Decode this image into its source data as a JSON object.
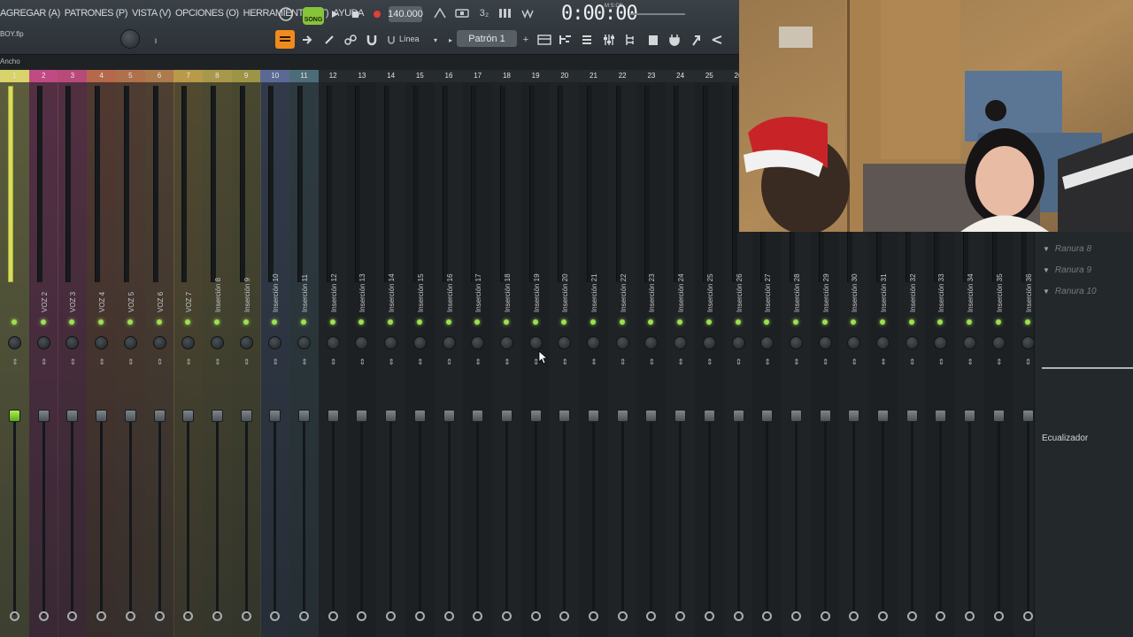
{
  "menu": [
    "AGREGAR (A)",
    "PATRONES (P)",
    "VISTA (V)",
    "OPCIONES (O)",
    "HERRAMIENTAS (T)",
    "AYUDA"
  ],
  "toolbar": {
    "song_label": "SONG",
    "tempo": "140.000",
    "time": "0:00:00",
    "time_unit": "M:S:CS",
    "filename": "BOY.flp",
    "snap_label": "Línea",
    "pattern_label": "Patrón 1",
    "icons": [
      "song-mode-icon",
      "play-icon",
      "stop-icon",
      "record-icon",
      "metronome-icon",
      "wait-input-icon",
      "countdown-icon",
      "step-edit-icon",
      "loop-record-icon",
      "playlist-icon",
      "piano-roll-icon",
      "mixer-icon",
      "channel-rack-icon",
      "browser-icon",
      "plugin-picker-icon"
    ]
  },
  "mixer": {
    "title": "Ancho",
    "tracks": [
      {
        "num": "1",
        "label": "",
        "color": "#d8d36a",
        "active": true
      },
      {
        "num": "2",
        "label": "VOZ 2",
        "color": "#c04a84"
      },
      {
        "num": "3",
        "label": "VOZ 3",
        "color": "#b84a7a"
      },
      {
        "num": "4",
        "label": "VOZ 4",
        "color": "#b6684a"
      },
      {
        "num": "5",
        "label": "VOZ 5",
        "color": "#b0704c"
      },
      {
        "num": "6",
        "label": "VOZ 6",
        "color": "#ac7a4c"
      },
      {
        "num": "7",
        "label": "VOZ 7",
        "color": "#b89a48"
      },
      {
        "num": "8",
        "label": "Inserción 8",
        "color": "#a8984a"
      },
      {
        "num": "9",
        "label": "Inserción 9",
        "color": "#9d9446"
      },
      {
        "num": "10",
        "label": "Inserción 10",
        "color": "#5a6a94"
      },
      {
        "num": "11",
        "label": "Inserción 11",
        "color": "#4c6d78"
      },
      {
        "num": "12",
        "label": "Inserción 12",
        "color": ""
      },
      {
        "num": "13",
        "label": "Inserción 13",
        "color": ""
      },
      {
        "num": "14",
        "label": "Inserción 14",
        "color": ""
      },
      {
        "num": "15",
        "label": "Inserción 15",
        "color": ""
      },
      {
        "num": "16",
        "label": "Inserción 16",
        "color": ""
      },
      {
        "num": "17",
        "label": "Inserción 17",
        "color": ""
      },
      {
        "num": "18",
        "label": "Inserción 18",
        "color": ""
      },
      {
        "num": "19",
        "label": "Inserción 19",
        "color": ""
      },
      {
        "num": "20",
        "label": "Inserción 20",
        "color": ""
      },
      {
        "num": "21",
        "label": "Inserción 21",
        "color": ""
      },
      {
        "num": "22",
        "label": "Inserción 22",
        "color": ""
      },
      {
        "num": "23",
        "label": "Inserción 23",
        "color": ""
      },
      {
        "num": "24",
        "label": "Inserción 24",
        "color": ""
      },
      {
        "num": "25",
        "label": "Inserción 25",
        "color": ""
      },
      {
        "num": "26",
        "label": "Inserción 26",
        "color": ""
      },
      {
        "num": "27",
        "label": "Inserción 27",
        "color": ""
      },
      {
        "num": "28",
        "label": "Inserción 28",
        "color": ""
      },
      {
        "num": "29",
        "label": "Inserción 29",
        "color": ""
      },
      {
        "num": "30",
        "label": "Inserción 30",
        "color": ""
      },
      {
        "num": "31",
        "label": "Inserción 31",
        "color": ""
      },
      {
        "num": "32",
        "label": "Inserción 32",
        "color": ""
      },
      {
        "num": "33",
        "label": "Inserción 33",
        "color": ""
      },
      {
        "num": "34",
        "label": "Inserción 34",
        "color": ""
      },
      {
        "num": "35",
        "label": "Inserción 35",
        "color": ""
      },
      {
        "num": "36",
        "label": "Inserción 36",
        "color": ""
      }
    ]
  },
  "panel": {
    "slots": [
      "Ranura 8",
      "Ranura 9",
      "Ranura 10"
    ],
    "eq_label": "Ecualizador"
  }
}
